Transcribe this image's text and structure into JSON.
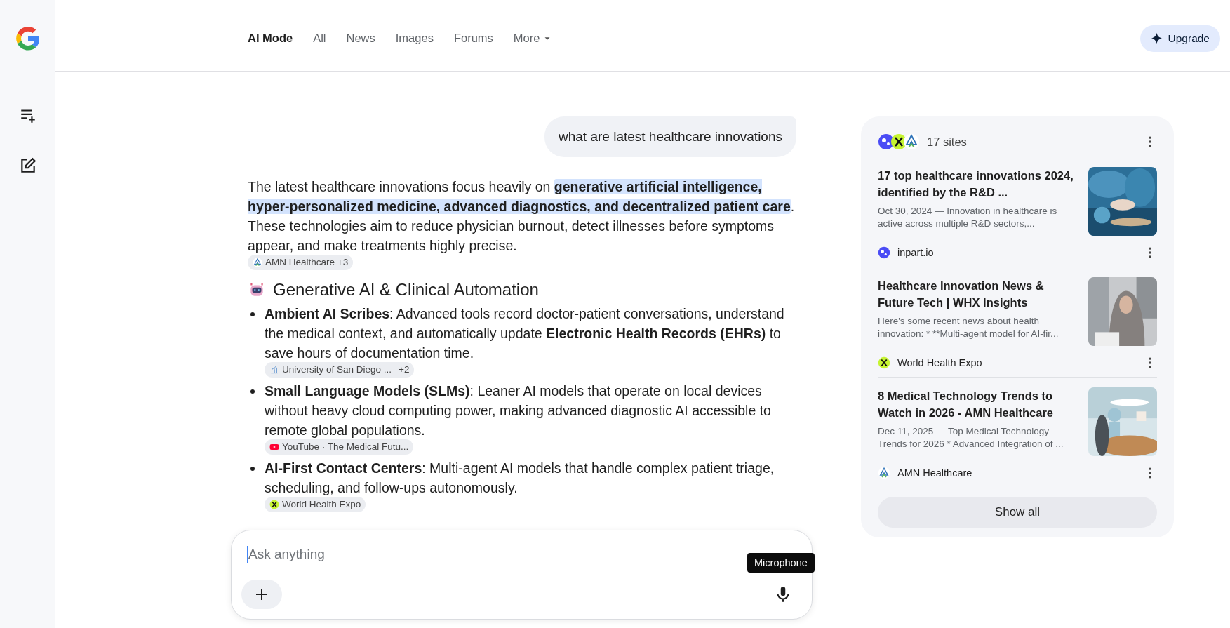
{
  "tabs": [
    {
      "label": "AI Mode",
      "selected": true,
      "kind": "tab"
    },
    {
      "label": "All",
      "selected": false,
      "kind": "tab"
    },
    {
      "label": "News",
      "selected": false,
      "kind": "tab"
    },
    {
      "label": "Images",
      "selected": false,
      "kind": "tab"
    },
    {
      "label": "Forums",
      "selected": false,
      "kind": "tab"
    },
    {
      "label": "More",
      "selected": false,
      "kind": "menu"
    }
  ],
  "upgrade_button": {
    "label": "Upgrade"
  },
  "query": "what are latest healthcare innovations",
  "answer": {
    "intro": {
      "text": "The latest healthcare innovations focus heavily on **generative artificial intelligence, hyper-personalized medicine, advanced diagnostics, and decentralized patient care**. These technologies aim to reduce physician burnout, detect illnesses before symptoms appear, and make treatments highly precise.",
      "source": {
        "kind": "amn",
        "label": "AMN Healthcare +3"
      }
    },
    "sections": [
      {
        "title": "Generative AI & Clinical Automation",
        "bullets": [
          {
            "text": "**Ambient AI Scribes**: Advanced tools record doctor-patient conversations, understand the medical context, and automatically update **Electronic Health Records (EHRs)** to save hours of documentation time.",
            "source": {
              "kind": "university",
              "label": "University of San Diego ...",
              "extra": "+2"
            }
          },
          {
            "text": "**Small Language Models (SLMs)**: Leaner AI models that operate on local devices without heavy cloud computing power, making advanced diagnostic AI accessible to remote global populations.",
            "source": {
              "kind": "youtube",
              "label": "YouTube · The Medical Futu..."
            }
          },
          {
            "text": "**AI-First Contact Centers**: Multi-agent AI models that handle complex patient triage, scheduling, and follow-ups autonomously.",
            "source": {
              "kind": "whx",
              "label": "World Health Expo"
            }
          }
        ]
      }
    ]
  },
  "sources": {
    "count_label": "17 sites",
    "results": [
      {
        "title": "17 top healthcare innovations 2024, identified by the R&D ...",
        "snippet": "Oct 30, 2024 — Innovation in healthcare is active across multiple R&D sectors,...",
        "site": "inpart.io",
        "kind": "inpart"
      },
      {
        "title": "Healthcare Innovation News & Future Tech | WHX Insights",
        "snippet": "Here's some recent news about health innovation: * **Multi-agent model for AI-fir...",
        "site": "World Health Expo",
        "kind": "whx"
      },
      {
        "title": "8 Medical Technology Trends to Watch in 2026 - AMN Healthcare",
        "snippet": "Dec 11, 2025 — Top Medical Technology Trends for 2026 * Advanced Integration of ...",
        "site": "AMN Healthcare",
        "kind": "amn"
      }
    ],
    "show_all": "Show all"
  },
  "input": {
    "placeholder": "Ask anything",
    "tooltip": "Microphone"
  }
}
